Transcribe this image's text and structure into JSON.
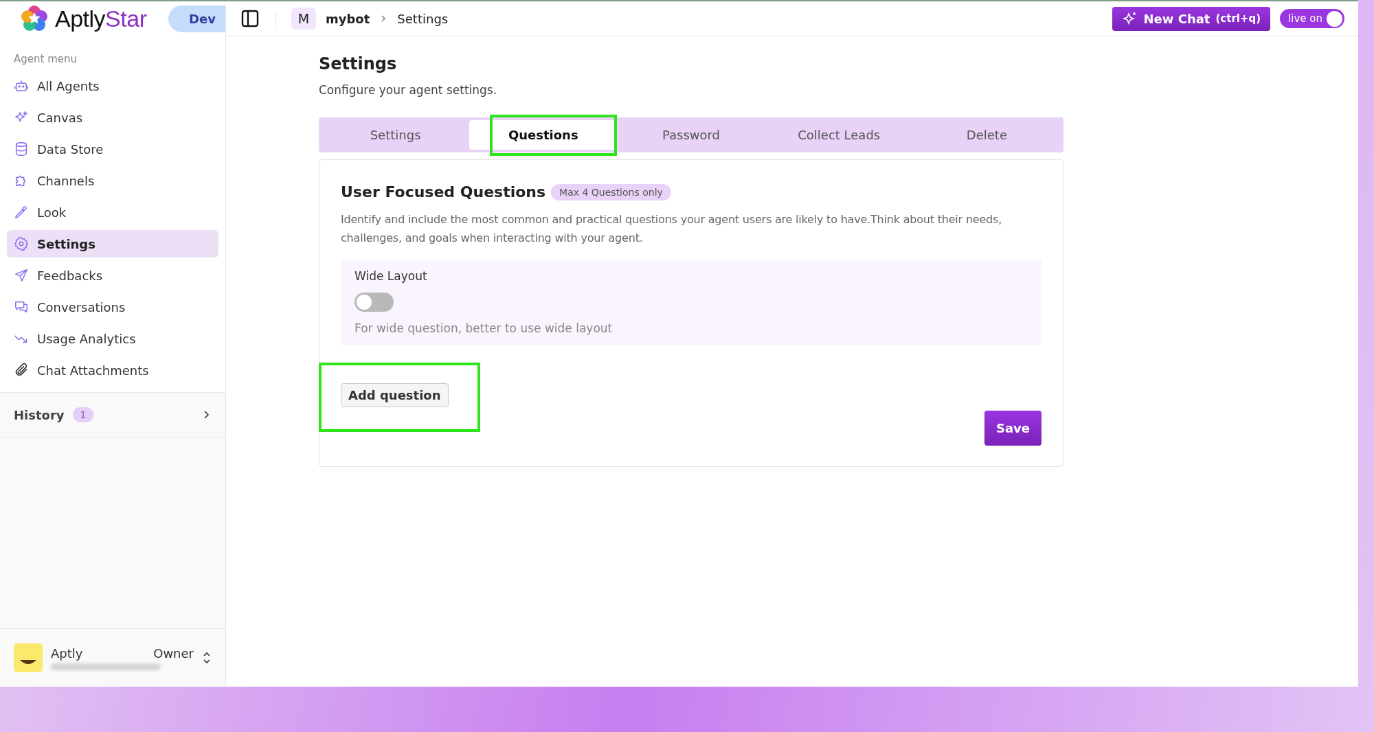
{
  "logo": {
    "name": "Aptly",
    "accent": "Star"
  },
  "env_badge": "Dev",
  "sidebar": {
    "section_label": "Agent menu",
    "items": [
      {
        "label": "All Agents",
        "selected": false
      },
      {
        "label": "Canvas",
        "selected": false
      },
      {
        "label": "Data Store",
        "selected": false
      },
      {
        "label": "Channels",
        "selected": false
      },
      {
        "label": "Look",
        "selected": false
      },
      {
        "label": "Settings",
        "selected": true
      },
      {
        "label": "Feedbacks",
        "selected": false
      },
      {
        "label": "Conversations",
        "selected": false
      },
      {
        "label": "Usage Analytics",
        "selected": false
      },
      {
        "label": "Chat Attachments",
        "selected": false
      }
    ],
    "history": {
      "label": "History",
      "count": "1"
    },
    "user": {
      "name": "Aptly",
      "role": "Owner"
    }
  },
  "topbar": {
    "breadcrumb": {
      "initial": "M",
      "agent": "mybot",
      "page": "Settings"
    },
    "new_chat": {
      "label": "New Chat",
      "shortcut": "(ctrl+q)"
    },
    "live": {
      "label": "live on",
      "on": true
    }
  },
  "page": {
    "title": "Settings",
    "subtitle": "Configure your agent settings.",
    "tabs": [
      {
        "label": "Settings",
        "selected": false,
        "highlighted": false
      },
      {
        "label": "Questions",
        "selected": true,
        "highlighted": true
      },
      {
        "label": "Password",
        "selected": false,
        "highlighted": false
      },
      {
        "label": "Collect Leads",
        "selected": false,
        "highlighted": false
      },
      {
        "label": "Delete",
        "selected": false,
        "highlighted": false
      }
    ],
    "card": {
      "title": "User Focused Questions",
      "badge": "Max 4 Questions only",
      "description": "Identify and include the most common and practical questions your agent users are likely to have.Think about their needs, challenges, and goals when interacting with your agent.",
      "wide_layout": {
        "label": "Wide Layout",
        "on": false,
        "hint": "For wide question, better to use wide layout"
      },
      "add_button": {
        "label": "Add question",
        "highlighted": true
      },
      "save_button": "Save"
    }
  }
}
